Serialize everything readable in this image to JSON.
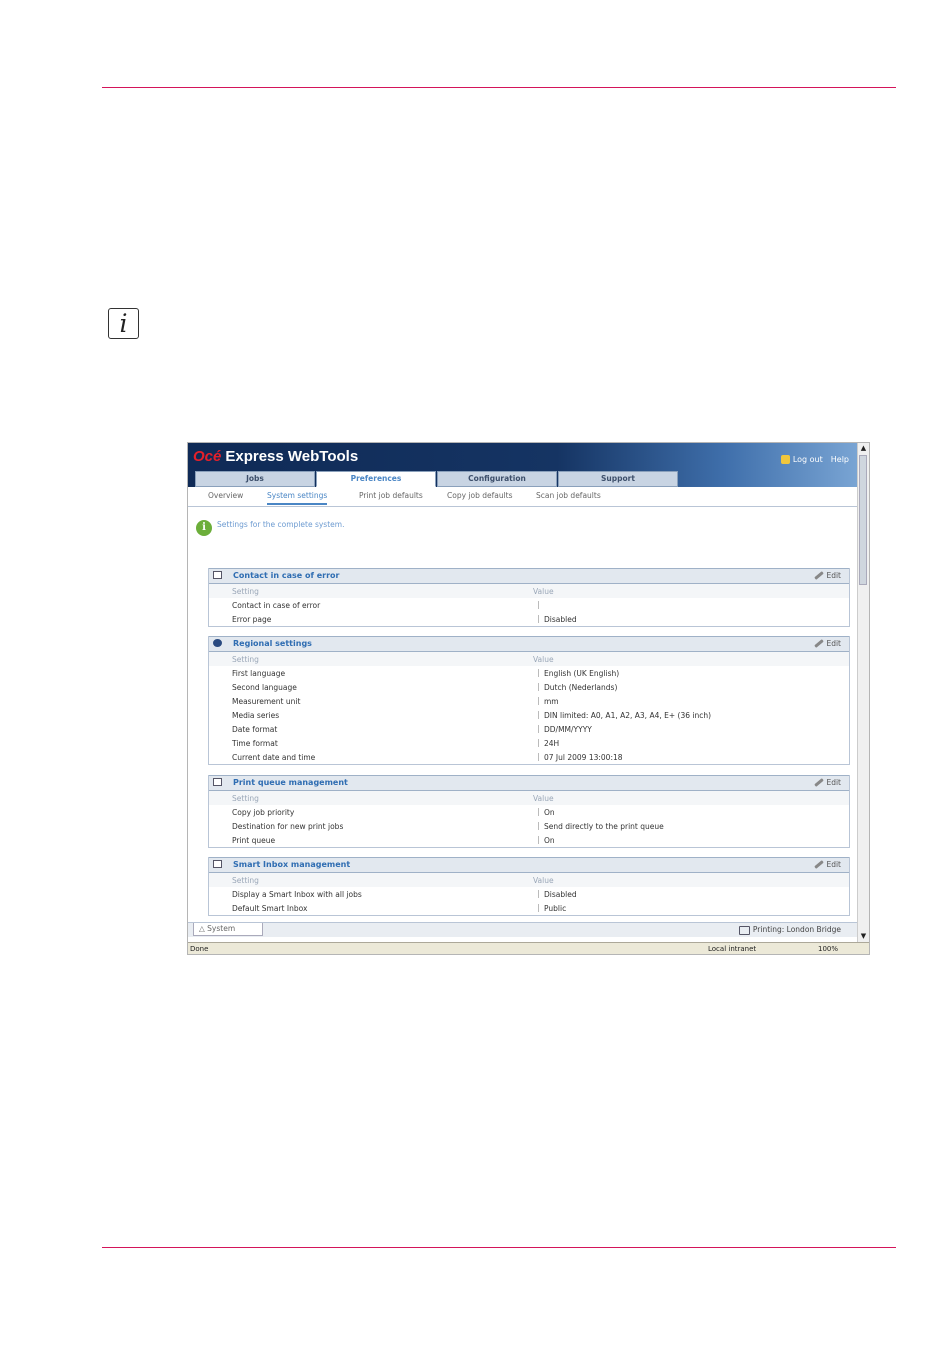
{
  "browser": {
    "brand_name": "Océ",
    "app_title": "Express WebTools",
    "header_links": [
      "Log out",
      "Help"
    ],
    "main_tabs": [
      "Jobs",
      "Preferences",
      "Configuration",
      "Support"
    ],
    "active_main_tab": "Preferences",
    "sub_tabs": [
      "Overview",
      "System settings",
      "Print job defaults",
      "Copy job defaults",
      "Scan job defaults"
    ],
    "active_sub_tab": "System settings",
    "info_text": "Settings for the complete system.",
    "column_setting": "Setting",
    "column_value": "Value",
    "edit_label": "Edit",
    "sections": [
      {
        "title": "Contact in case of error",
        "rows": [
          {
            "setting": "Contact in case of error",
            "value": ""
          },
          {
            "setting": "Error page",
            "value": "Disabled"
          }
        ]
      },
      {
        "title": "Regional settings",
        "rows": [
          {
            "setting": "First language",
            "value": "English (UK English)"
          },
          {
            "setting": "Second language",
            "value": "Dutch (Nederlands)"
          },
          {
            "setting": "Measurement unit",
            "value": "mm"
          },
          {
            "setting": "Media series",
            "value": "DIN limited: A0, A1, A2, A3, A4, E+ (36 inch)"
          },
          {
            "setting": "Date format",
            "value": "DD/MM/YYYY"
          },
          {
            "setting": "Time format",
            "value": "24H"
          },
          {
            "setting": "Current date and time",
            "value": "07 Jul 2009 13:00:18"
          }
        ]
      },
      {
        "title": "Print queue management",
        "rows": [
          {
            "setting": "Copy job priority",
            "value": "On"
          },
          {
            "setting": "Destination for new print jobs",
            "value": "Send directly to the print queue"
          },
          {
            "setting": "Print queue",
            "value": "On"
          }
        ]
      },
      {
        "title": "Smart Inbox management",
        "rows": [
          {
            "setting": "Display a Smart Inbox with all jobs",
            "value": "Disabled"
          },
          {
            "setting": "Default Smart Inbox",
            "value": "Public"
          }
        ]
      }
    ],
    "bottom_tab": "System",
    "printing_label": "Printing:",
    "printing_value": "London Bridge",
    "status_done": "Done",
    "status_zone": "Local intranet",
    "status_zoom": "100%"
  }
}
